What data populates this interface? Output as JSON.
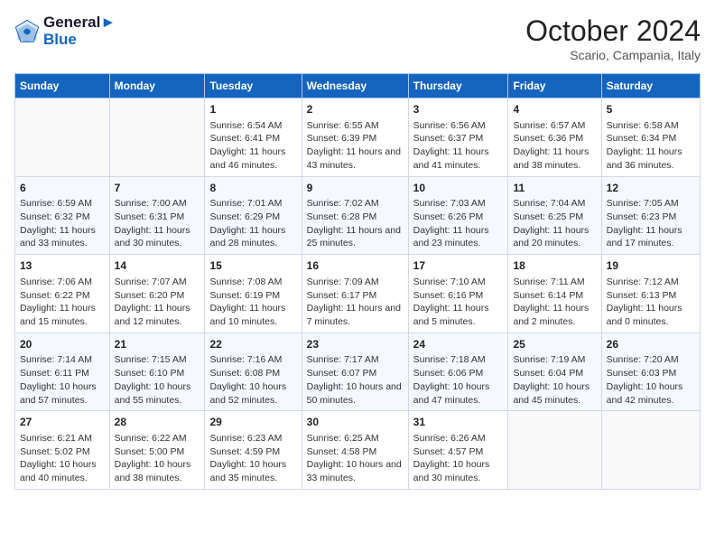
{
  "header": {
    "logo_line1": "General",
    "logo_line2": "Blue",
    "month": "October 2024",
    "location": "Scario, Campania, Italy"
  },
  "weekdays": [
    "Sunday",
    "Monday",
    "Tuesday",
    "Wednesday",
    "Thursday",
    "Friday",
    "Saturday"
  ],
  "weeks": [
    [
      {
        "day": "",
        "info": ""
      },
      {
        "day": "",
        "info": ""
      },
      {
        "day": "1",
        "info": "Sunrise: 6:54 AM\nSunset: 6:41 PM\nDaylight: 11 hours and 46 minutes."
      },
      {
        "day": "2",
        "info": "Sunrise: 6:55 AM\nSunset: 6:39 PM\nDaylight: 11 hours and 43 minutes."
      },
      {
        "day": "3",
        "info": "Sunrise: 6:56 AM\nSunset: 6:37 PM\nDaylight: 11 hours and 41 minutes."
      },
      {
        "day": "4",
        "info": "Sunrise: 6:57 AM\nSunset: 6:36 PM\nDaylight: 11 hours and 38 minutes."
      },
      {
        "day": "5",
        "info": "Sunrise: 6:58 AM\nSunset: 6:34 PM\nDaylight: 11 hours and 36 minutes."
      }
    ],
    [
      {
        "day": "6",
        "info": "Sunrise: 6:59 AM\nSunset: 6:32 PM\nDaylight: 11 hours and 33 minutes."
      },
      {
        "day": "7",
        "info": "Sunrise: 7:00 AM\nSunset: 6:31 PM\nDaylight: 11 hours and 30 minutes."
      },
      {
        "day": "8",
        "info": "Sunrise: 7:01 AM\nSunset: 6:29 PM\nDaylight: 11 hours and 28 minutes."
      },
      {
        "day": "9",
        "info": "Sunrise: 7:02 AM\nSunset: 6:28 PM\nDaylight: 11 hours and 25 minutes."
      },
      {
        "day": "10",
        "info": "Sunrise: 7:03 AM\nSunset: 6:26 PM\nDaylight: 11 hours and 23 minutes."
      },
      {
        "day": "11",
        "info": "Sunrise: 7:04 AM\nSunset: 6:25 PM\nDaylight: 11 hours and 20 minutes."
      },
      {
        "day": "12",
        "info": "Sunrise: 7:05 AM\nSunset: 6:23 PM\nDaylight: 11 hours and 17 minutes."
      }
    ],
    [
      {
        "day": "13",
        "info": "Sunrise: 7:06 AM\nSunset: 6:22 PM\nDaylight: 11 hours and 15 minutes."
      },
      {
        "day": "14",
        "info": "Sunrise: 7:07 AM\nSunset: 6:20 PM\nDaylight: 11 hours and 12 minutes."
      },
      {
        "day": "15",
        "info": "Sunrise: 7:08 AM\nSunset: 6:19 PM\nDaylight: 11 hours and 10 minutes."
      },
      {
        "day": "16",
        "info": "Sunrise: 7:09 AM\nSunset: 6:17 PM\nDaylight: 11 hours and 7 minutes."
      },
      {
        "day": "17",
        "info": "Sunrise: 7:10 AM\nSunset: 6:16 PM\nDaylight: 11 hours and 5 minutes."
      },
      {
        "day": "18",
        "info": "Sunrise: 7:11 AM\nSunset: 6:14 PM\nDaylight: 11 hours and 2 minutes."
      },
      {
        "day": "19",
        "info": "Sunrise: 7:12 AM\nSunset: 6:13 PM\nDaylight: 11 hours and 0 minutes."
      }
    ],
    [
      {
        "day": "20",
        "info": "Sunrise: 7:14 AM\nSunset: 6:11 PM\nDaylight: 10 hours and 57 minutes."
      },
      {
        "day": "21",
        "info": "Sunrise: 7:15 AM\nSunset: 6:10 PM\nDaylight: 10 hours and 55 minutes."
      },
      {
        "day": "22",
        "info": "Sunrise: 7:16 AM\nSunset: 6:08 PM\nDaylight: 10 hours and 52 minutes."
      },
      {
        "day": "23",
        "info": "Sunrise: 7:17 AM\nSunset: 6:07 PM\nDaylight: 10 hours and 50 minutes."
      },
      {
        "day": "24",
        "info": "Sunrise: 7:18 AM\nSunset: 6:06 PM\nDaylight: 10 hours and 47 minutes."
      },
      {
        "day": "25",
        "info": "Sunrise: 7:19 AM\nSunset: 6:04 PM\nDaylight: 10 hours and 45 minutes."
      },
      {
        "day": "26",
        "info": "Sunrise: 7:20 AM\nSunset: 6:03 PM\nDaylight: 10 hours and 42 minutes."
      }
    ],
    [
      {
        "day": "27",
        "info": "Sunrise: 6:21 AM\nSunset: 5:02 PM\nDaylight: 10 hours and 40 minutes."
      },
      {
        "day": "28",
        "info": "Sunrise: 6:22 AM\nSunset: 5:00 PM\nDaylight: 10 hours and 38 minutes."
      },
      {
        "day": "29",
        "info": "Sunrise: 6:23 AM\nSunset: 4:59 PM\nDaylight: 10 hours and 35 minutes."
      },
      {
        "day": "30",
        "info": "Sunrise: 6:25 AM\nSunset: 4:58 PM\nDaylight: 10 hours and 33 minutes."
      },
      {
        "day": "31",
        "info": "Sunrise: 6:26 AM\nSunset: 4:57 PM\nDaylight: 10 hours and 30 minutes."
      },
      {
        "day": "",
        "info": ""
      },
      {
        "day": "",
        "info": ""
      }
    ]
  ]
}
